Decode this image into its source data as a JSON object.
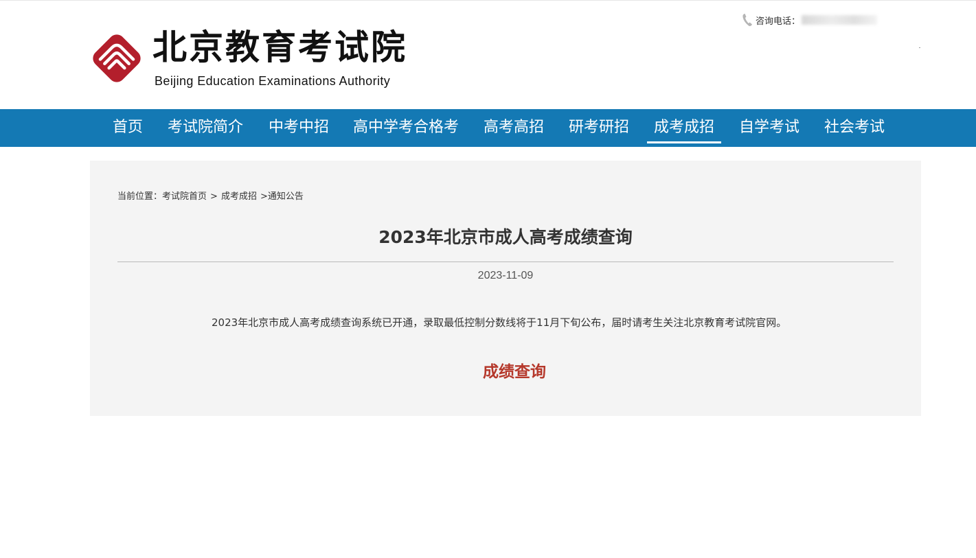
{
  "header": {
    "logo_title": "北京教育考试院",
    "logo_subtitle": "Beijing Education Examinations Authority",
    "contact_label": "咨询电话："
  },
  "nav": {
    "items": [
      {
        "label": "首页"
      },
      {
        "label": "考试院简介"
      },
      {
        "label": "中考中招"
      },
      {
        "label": "高中学考合格考"
      },
      {
        "label": "高考高招"
      },
      {
        "label": "研考研招"
      },
      {
        "label": "成考成招",
        "active": true
      },
      {
        "label": "自学考试"
      },
      {
        "label": "社会考试"
      }
    ]
  },
  "breadcrumb": {
    "prefix": "当前位置：",
    "home": "考试院首页",
    "section": "成考成招",
    "current": "通知公告"
  },
  "article": {
    "title": "2023年北京市成人高考成绩查询",
    "date": "2023-11-09",
    "body": "2023年北京市成人高考成绩查询系统已开通，录取最低控制分数线将于11月下旬公布，届时请考生关注北京教育考试院官网。",
    "link_label": "成绩查询"
  },
  "colors": {
    "nav_bg": "#1479b4",
    "logo_red": "#b31f2c",
    "link_red": "#b5382b",
    "panel_bg": "#f4f4f4"
  }
}
